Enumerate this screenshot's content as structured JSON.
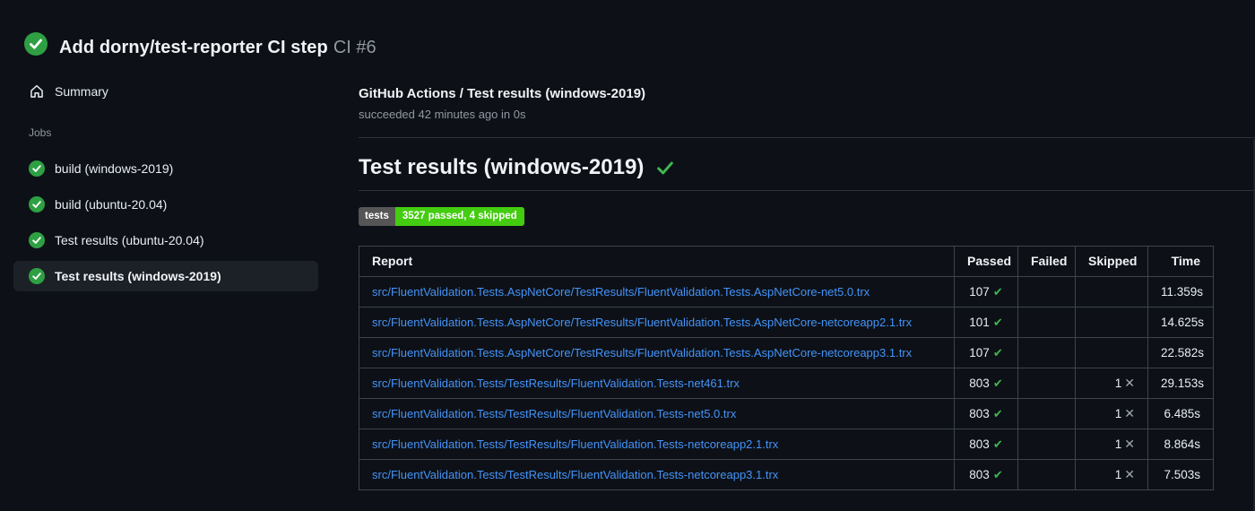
{
  "header": {
    "title": "Add dorny/test-reporter CI step",
    "run_number": "CI #6"
  },
  "sidebar": {
    "summary_label": "Summary",
    "jobs_label": "Jobs",
    "jobs": [
      {
        "label": "build (windows-2019)",
        "selected": false
      },
      {
        "label": "build (ubuntu-20.04)",
        "selected": false
      },
      {
        "label": "Test results (ubuntu-20.04)",
        "selected": false
      },
      {
        "label": "Test results (windows-2019)",
        "selected": true
      }
    ]
  },
  "main": {
    "check_title": "GitHub Actions / Test results (windows-2019)",
    "check_status": "succeeded 42 minutes ago in 0s",
    "section_title": "Test results (windows-2019)",
    "badge": {
      "label": "tests",
      "value": "3527 passed, 4 skipped"
    },
    "table": {
      "columns": [
        "Report",
        "Passed",
        "Failed",
        "Skipped",
        "Time"
      ],
      "rows": [
        {
          "report": "src/FluentValidation.Tests.AspNetCore/TestResults/FluentValidation.Tests.AspNetCore-net5.0.trx",
          "passed": "107",
          "failed": "",
          "skipped": "",
          "time": "11.359s"
        },
        {
          "report": "src/FluentValidation.Tests.AspNetCore/TestResults/FluentValidation.Tests.AspNetCore-netcoreapp2.1.trx",
          "passed": "101",
          "failed": "",
          "skipped": "",
          "time": "14.625s"
        },
        {
          "report": "src/FluentValidation.Tests.AspNetCore/TestResults/FluentValidation.Tests.AspNetCore-netcoreapp3.1.trx",
          "passed": "107",
          "failed": "",
          "skipped": "",
          "time": "22.582s"
        },
        {
          "report": "src/FluentValidation.Tests/TestResults/FluentValidation.Tests-net461.trx",
          "passed": "803",
          "failed": "",
          "skipped": "1",
          "time": "29.153s"
        },
        {
          "report": "src/FluentValidation.Tests/TestResults/FluentValidation.Tests-net5.0.trx",
          "passed": "803",
          "failed": "",
          "skipped": "1",
          "time": "6.485s"
        },
        {
          "report": "src/FluentValidation.Tests/TestResults/FluentValidation.Tests-netcoreapp2.1.trx",
          "passed": "803",
          "failed": "",
          "skipped": "1",
          "time": "8.864s"
        },
        {
          "report": "src/FluentValidation.Tests/TestResults/FluentValidation.Tests-netcoreapp3.1.trx",
          "passed": "803",
          "failed": "",
          "skipped": "1",
          "time": "7.503s"
        }
      ]
    }
  },
  "icons": {
    "passed_check": "✔",
    "skipped_x": "✕",
    "section_check": "check-icon",
    "status_circle": "check-circle-icon",
    "home": "home-icon"
  },
  "colors": {
    "bg": "#0d1117",
    "selected_bg": "#1c2128",
    "success_green": "#3fb950",
    "circle_green": "#2ea043",
    "badge_gray": "#555555",
    "badge_green": "#44cc11",
    "link_blue": "#4493f8",
    "border": "#3d444d",
    "muted_text": "#9198a1"
  }
}
